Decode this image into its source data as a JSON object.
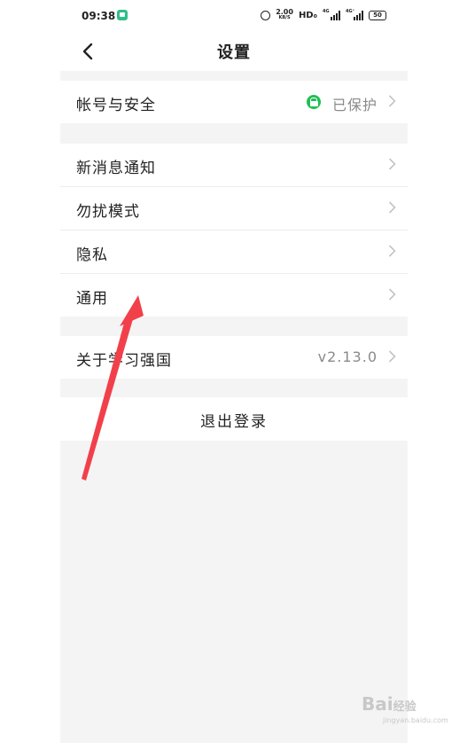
{
  "status_bar": {
    "time": "09:38",
    "net_speed": "2.00",
    "net_speed_unit": "KB/S",
    "hd_label": "HD₀",
    "signal1_label": "4G",
    "signal2_label": "4G⁺",
    "battery": "50"
  },
  "header": {
    "title": "设置",
    "back_icon": "chevron-left-icon"
  },
  "groups": {
    "account": {
      "label": "帐号与安全",
      "status": "已保护",
      "status_icon": "lock-icon",
      "status_color": "#1fbf56"
    },
    "notifications": {
      "label": "新消息通知"
    },
    "dnd": {
      "label": "勿扰模式"
    },
    "privacy": {
      "label": "隐私"
    },
    "general": {
      "label": "通用"
    },
    "about": {
      "label": "关于学习强国",
      "version": "v2.13.0"
    }
  },
  "logout_label": "退出登录",
  "annotation": {
    "color": "#f2404a",
    "icon": "red-arrow-annotation"
  },
  "watermark": {
    "brand": "Bai",
    "brand_suffix": "经验",
    "sub": "jingyan.baidu.com"
  },
  "colors": {
    "background": "#f4f4f4",
    "accent_green": "#1fbf56",
    "text": "#222222",
    "muted": "#8a8a8a"
  }
}
